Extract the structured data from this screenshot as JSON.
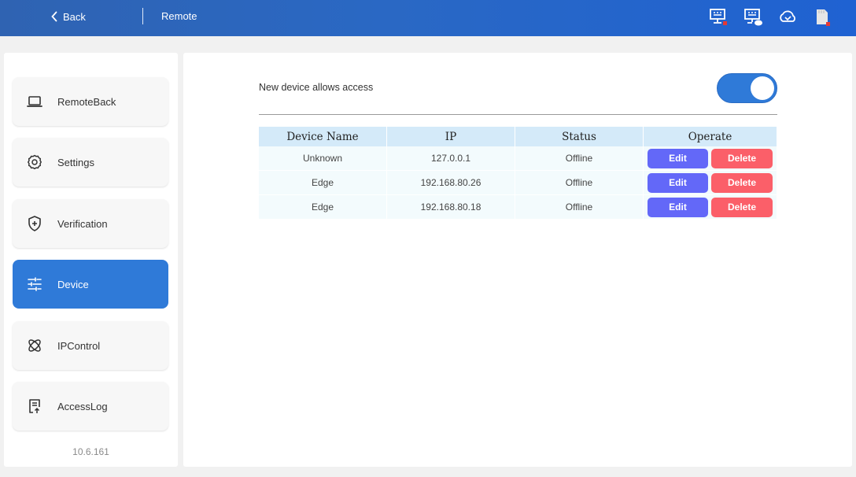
{
  "header": {
    "back_label": "Back",
    "title": "Remote",
    "status_icons": [
      "network-error-icon",
      "network-cloud-icon",
      "cloud-sync-icon",
      "sd-card-error-icon"
    ]
  },
  "sidebar": {
    "items": [
      {
        "label": "RemoteBack",
        "icon": "laptop-icon",
        "active": false
      },
      {
        "label": "Settings",
        "icon": "gear-icon",
        "active": false
      },
      {
        "label": "Verification",
        "icon": "shield-plus-icon",
        "active": false
      },
      {
        "label": "Device",
        "icon": "sliders-icon",
        "active": true
      },
      {
        "label": "IPControl",
        "icon": "atom-icon",
        "active": false
      },
      {
        "label": "AccessLog",
        "icon": "log-upload-icon",
        "active": false
      }
    ],
    "version": "10.6.161"
  },
  "main": {
    "access_label": "New device allows access",
    "access_enabled": true,
    "table": {
      "headers": [
        "Device Name",
        "IP",
        "Status",
        "Operate"
      ],
      "rows": [
        {
          "name": "Unknown",
          "ip": "127.0.0.1",
          "status": "Offline"
        },
        {
          "name": "Edge",
          "ip": "192.168.80.26",
          "status": "Offline"
        },
        {
          "name": "Edge",
          "ip": "192.168.80.18",
          "status": "Offline"
        }
      ],
      "edit_label": "Edit",
      "delete_label": "Delete"
    }
  },
  "colors": {
    "accent": "#2f7ad8",
    "edit_button": "#6368f8",
    "delete_button": "#fb5f69",
    "header_cell": "#d4eaf9"
  }
}
